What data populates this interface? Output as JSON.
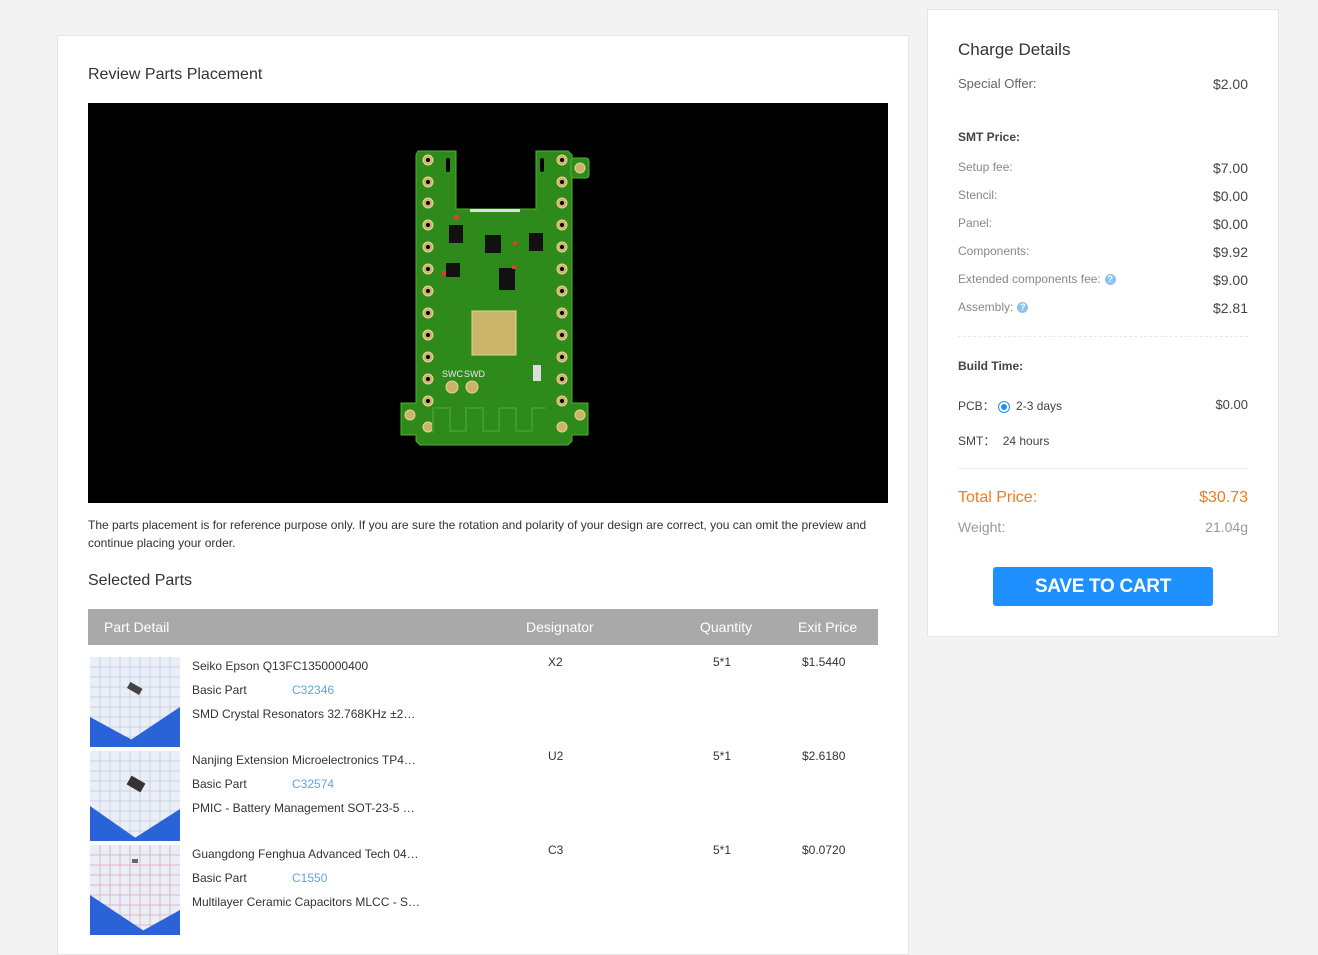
{
  "review": {
    "title": "Review Parts Placement",
    "note": "The parts placement is for reference purpose only. If you are sure the rotation and polarity of your design are correct, you can omit the preview and continue placing your order.",
    "pcb_labels": {
      "swc": "SWC",
      "swd": "SWD"
    }
  },
  "selected": {
    "title": "Selected Parts",
    "headers": [
      "Part Detail",
      "Designator",
      "Quantity",
      "Exit Price"
    ],
    "rows": [
      {
        "name": "Seiko Epson Q13FC1350000400",
        "type": "Basic Part",
        "code": "C32346",
        "desc": "SMD Crystal Resonators 32.768KHz ±2…",
        "designator": "X2",
        "quantity": "5*1",
        "price": "$1.5440"
      },
      {
        "name": "Nanjing Extension Microelectronics TP4…",
        "type": "Basic Part",
        "code": "C32574",
        "desc": "PMIC - Battery Management SOT-23-5 …",
        "designator": "U2",
        "quantity": "5*1",
        "price": "$2.6180"
      },
      {
        "name": "Guangdong Fenghua Advanced Tech 04…",
        "type": "Basic Part",
        "code": "C1550",
        "desc": "Multilayer Ceramic Capacitors MLCC - S…",
        "designator": "C3",
        "quantity": "5*1",
        "price": "$0.0720"
      }
    ]
  },
  "charge": {
    "title": "Charge Details",
    "special_offer": {
      "label": "Special Offer:",
      "value": "$2.00"
    },
    "smt_title": "SMT Price:",
    "smt": [
      {
        "label": "Setup fee:",
        "value": "$7.00"
      },
      {
        "label": "Stencil:",
        "value": "$0.00"
      },
      {
        "label": "Panel:",
        "value": "$0.00"
      },
      {
        "label": "Components:",
        "value": "$9.92"
      },
      {
        "label": "Extended components fee:",
        "value": "$9.00"
      },
      {
        "label": "Assembly:",
        "value": "$2.81"
      }
    ],
    "help_glyph": "?",
    "build_title": "Build Time:",
    "pcb": {
      "label": "PCB：",
      "option": "2-3 days",
      "value": "$0.00"
    },
    "smt_time": {
      "label": "SMT：",
      "value": "24 hours"
    },
    "total": {
      "label": "Total Price:",
      "value": "$30.73"
    },
    "weight": {
      "label": "Weight:",
      "value": "21.04g"
    },
    "save_label": "SAVE TO CART"
  },
  "colors": {
    "accent": "#1e90ff",
    "total": "#f07c1e",
    "link": "#5aa8e6",
    "pcb_green": "#2f8a1c",
    "header_gray": "#a9a9a9"
  }
}
